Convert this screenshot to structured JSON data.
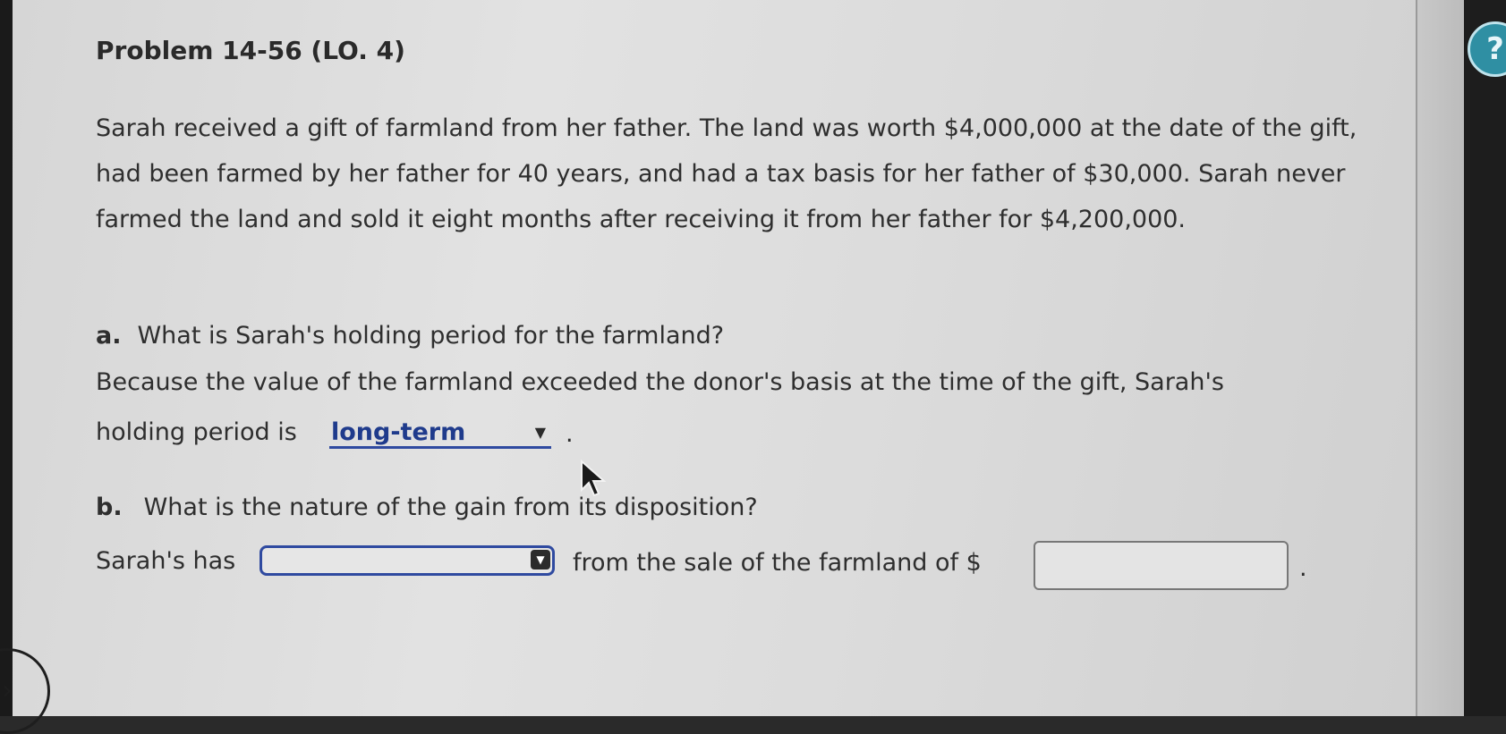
{
  "problem": {
    "title": "Problem 14-56 (LO. 4)",
    "paragraph": "Sarah received a gift of farmland from her father. The land was worth $4,000,000 at the date of the gift, had been farmed by her father for 40 years, and had a tax basis for her father of $30,000. Sarah never farmed the land and sold it eight months after receiving it from her father for $4,200,000."
  },
  "part_a": {
    "letter": "a.",
    "question": "What is Sarah's holding period for the farmland?",
    "line1": "Because the value of the farmland exceeded the donor's basis at the time of the gift, Sarah's",
    "line2_prefix": "holding period is",
    "dropdown_value": "long-term",
    "line2_suffix": "."
  },
  "part_b": {
    "letter": "b.",
    "question": "What is the nature of the gain from its disposition?",
    "prefix": "Sarah's has",
    "dropdown_value": "",
    "middle": "from the sale of the farmland of $",
    "amount_value": "",
    "suffix": "."
  },
  "icons": {
    "dropdown": "caret-down-icon",
    "cursor": "mouse-pointer-icon",
    "help": "help-icon",
    "nav": "chevron-right-icon"
  },
  "colors": {
    "accent": "#2f4aa0",
    "selected_text": "#1f3b8c",
    "help": "#2f8fa3"
  }
}
